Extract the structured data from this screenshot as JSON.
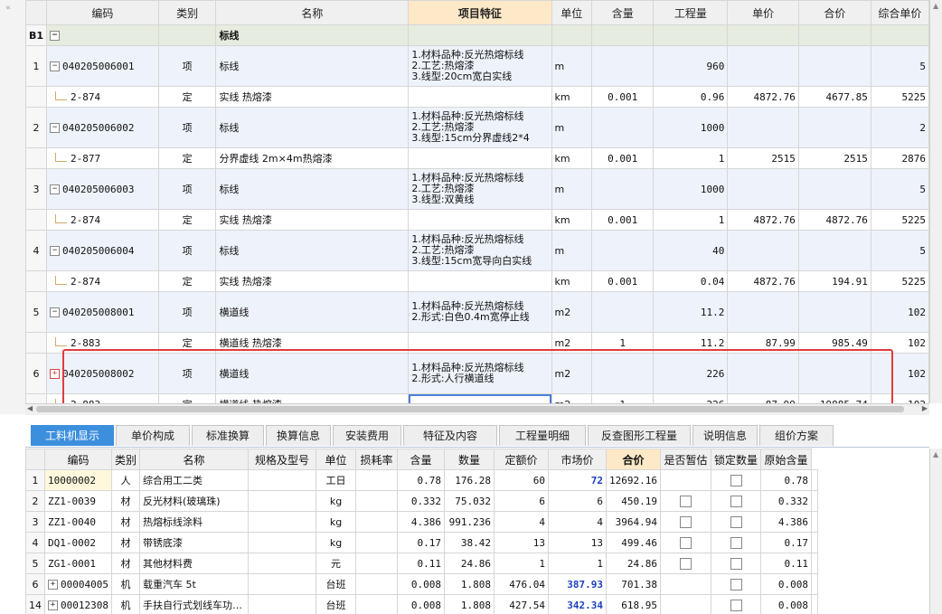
{
  "top_grid": {
    "columns": [
      "编码",
      "类别",
      "名称",
      "项目特征",
      "单位",
      "含量",
      "工程量",
      "单价",
      "合价",
      "综合单价"
    ],
    "group": {
      "row_label": "B1",
      "name": "标线"
    },
    "rows": [
      {
        "kind": "item",
        "no": "1",
        "code": "040205006001",
        "type": "项",
        "name": "标线",
        "features": [
          "1.材料品种:反光热熔标线",
          "2.工艺:热熔漆",
          "3.线型:20cm宽白实线"
        ],
        "unit": "m",
        "content": "",
        "qty": "960",
        "price": "",
        "total": "",
        "unit_total": "5"
      },
      {
        "kind": "def",
        "code": "2-874",
        "type": "定",
        "name": "实线 热熔漆",
        "unit": "km",
        "content": "0.001",
        "qty": "0.96",
        "price": "4872.76",
        "total": "4677.85",
        "unit_total": "5225"
      },
      {
        "kind": "item",
        "no": "2",
        "code": "040205006002",
        "type": "项",
        "name": "标线",
        "features": [
          "1.材料品种:反光热熔标线",
          "2.工艺:热熔漆",
          "3.线型:15cm分界虚线2*4"
        ],
        "unit": "m",
        "content": "",
        "qty": "1000",
        "price": "",
        "total": "",
        "unit_total": "2"
      },
      {
        "kind": "def",
        "code": "2-877",
        "type": "定",
        "name": "分界虚线 2m×4m热熔漆",
        "unit": "km",
        "content": "0.001",
        "qty": "1",
        "price": "2515",
        "total": "2515",
        "unit_total": "2876"
      },
      {
        "kind": "item",
        "no": "3",
        "code": "040205006003",
        "type": "项",
        "name": "标线",
        "features": [
          "1.材料品种:反光热熔标线",
          "2.工艺:热熔漆",
          "3.线型:双黄线"
        ],
        "unit": "m",
        "content": "",
        "qty": "1000",
        "price": "",
        "total": "",
        "unit_total": "5"
      },
      {
        "kind": "def",
        "code": "2-874",
        "type": "定",
        "name": "实线 热熔漆",
        "unit": "km",
        "content": "0.001",
        "qty": "1",
        "price": "4872.76",
        "total": "4872.76",
        "unit_total": "5225"
      },
      {
        "kind": "item",
        "no": "4",
        "code": "040205006004",
        "type": "项",
        "name": "标线",
        "features": [
          "1.材料品种:反光热熔标线",
          "2.工艺:热熔漆",
          "3.线型:15cm宽导向白实线"
        ],
        "unit": "m",
        "content": "",
        "qty": "40",
        "price": "",
        "total": "",
        "unit_total": "5"
      },
      {
        "kind": "def",
        "code": "2-874",
        "type": "定",
        "name": "实线 热熔漆",
        "unit": "km",
        "content": "0.001",
        "qty": "0.04",
        "price": "4872.76",
        "total": "194.91",
        "unit_total": "5225"
      },
      {
        "kind": "item",
        "no": "5",
        "code": "040205008001",
        "type": "项",
        "name": "横道线",
        "features": [
          "1.材料品种:反光热熔标线",
          "2.形式:白色0.4m宽停止线"
        ],
        "unit": "m2",
        "content": "",
        "qty": "11.2",
        "price": "",
        "total": "",
        "unit_total": "102"
      },
      {
        "kind": "def",
        "code": "2-883",
        "type": "定",
        "name": "横道线 热熔漆",
        "unit": "m2",
        "content": "1",
        "qty": "11.2",
        "price": "87.99",
        "total": "985.49",
        "unit_total": "102"
      },
      {
        "kind": "item",
        "no": "6",
        "code": "040205008002",
        "type": "项",
        "name": "横道线",
        "features": [
          "1.材料品种:反光热熔标线",
          "2.形式:人行横道线"
        ],
        "unit": "m2",
        "content": "",
        "qty": "226",
        "price": "",
        "total": "",
        "unit_total": "102"
      },
      {
        "kind": "def",
        "code": "2-883",
        "type": "定",
        "name": "横道线 热熔漆",
        "unit": "m2",
        "content": "1",
        "qty": "226",
        "price": "87.99",
        "total": "19885.74",
        "unit_total": "102"
      }
    ]
  },
  "tabs": [
    "工料机显示",
    "单价构成",
    "标准换算",
    "换算信息",
    "安装费用",
    "特征及内容",
    "工程量明细",
    "反查图形工程量",
    "说明信息",
    "组价方案"
  ],
  "bottom_grid": {
    "columns": [
      "编码",
      "类别",
      "名称",
      "规格及型号",
      "单位",
      "损耗率",
      "含量",
      "数量",
      "定额价",
      "市场价",
      "合价",
      "是否暂估",
      "锁定数量",
      "原始含量"
    ],
    "rows": [
      {
        "no": "1",
        "code": "10000002",
        "type": "人",
        "name": "综合用工二类",
        "spec": "",
        "unit": "工日",
        "loss": "",
        "content": "0.78",
        "amount": "176.28",
        "quota": "60",
        "market": "72",
        "total": "12692.16",
        "est": false,
        "lock": true,
        "orig": "0.78"
      },
      {
        "no": "2",
        "code": "ZZ1-0039",
        "type": "材",
        "name": "反光材料(玻璃珠)",
        "spec": "",
        "unit": "kg",
        "loss": "",
        "content": "0.332",
        "amount": "75.032",
        "quota": "6",
        "market": "6",
        "total": "450.19",
        "est": true,
        "lock": true,
        "orig": "0.332"
      },
      {
        "no": "3",
        "code": "ZZ1-0040",
        "type": "材",
        "name": "热熔标线涂料",
        "spec": "",
        "unit": "kg",
        "loss": "",
        "content": "4.386",
        "amount": "991.236",
        "quota": "4",
        "market": "4",
        "total": "3964.94",
        "est": true,
        "lock": true,
        "orig": "4.386"
      },
      {
        "no": "4",
        "code": "DQ1-0002",
        "type": "材",
        "name": "带锈底漆",
        "spec": "",
        "unit": "kg",
        "loss": "",
        "content": "0.17",
        "amount": "38.42",
        "quota": "13",
        "market": "13",
        "total": "499.46",
        "est": true,
        "lock": true,
        "orig": "0.17"
      },
      {
        "no": "5",
        "code": "ZG1-0001",
        "type": "材",
        "name": "其他材料费",
        "spec": "",
        "unit": "元",
        "loss": "",
        "content": "0.11",
        "amount": "24.86",
        "quota": "1",
        "market": "1",
        "total": "24.86",
        "est": true,
        "lock": true,
        "orig": "0.11"
      },
      {
        "no": "6",
        "code": "00004005",
        "type": "机",
        "name": "载重汽车 5t",
        "spec": "",
        "unit": "台班",
        "loss": "",
        "content": "0.008",
        "amount": "1.808",
        "quota": "476.04",
        "market": "387.93",
        "total": "701.38",
        "est": false,
        "lock": true,
        "orig": "0.008",
        "expandable": true,
        "market_blue": true
      },
      {
        "no": "14",
        "code": "00012308",
        "type": "机",
        "name": "手扶自行式划线车功…",
        "spec": "",
        "unit": "台班",
        "loss": "",
        "content": "0.008",
        "amount": "1.808",
        "quota": "427.54",
        "market": "342.34",
        "total": "618.95",
        "est": false,
        "lock": true,
        "orig": "0.008",
        "expandable": true,
        "market_blue": true
      }
    ]
  }
}
